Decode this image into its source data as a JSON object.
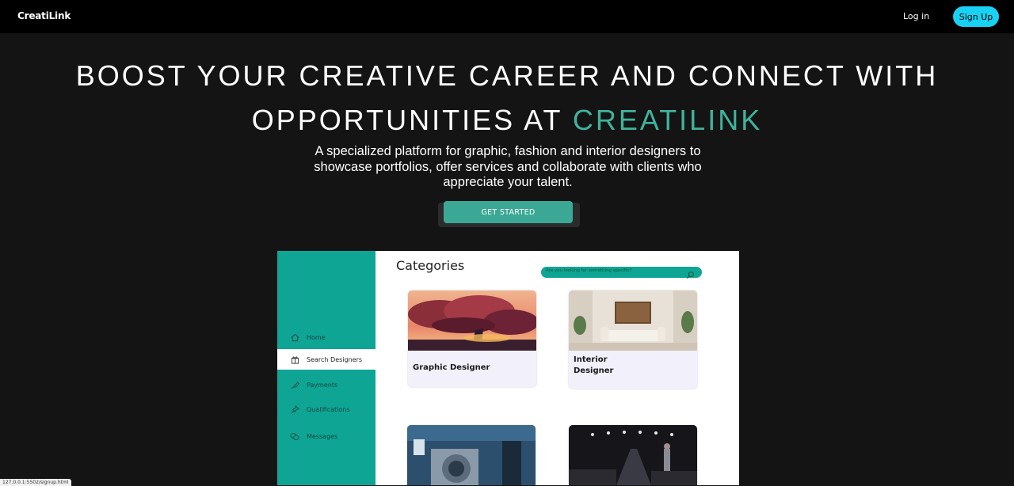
{
  "nav": {
    "logo": "CreatiLink",
    "login": "Log in",
    "signup": "Sign Up"
  },
  "hero": {
    "title_line1": "BOOST YOUR CREATIVE CAREER AND CONNECT WITH",
    "title_line2_prefix": "OPPORTUNITIES AT ",
    "title_brand": "CREATILINK",
    "subtitle": "A specialized platform for graphic, fashion and interior designers to showcase portfolios, offer services and collaborate with clients who appreciate your talent.",
    "cta": "GET STARTED"
  },
  "preview": {
    "sidebar": [
      {
        "label": "Home",
        "icon": "home-icon"
      },
      {
        "label": "Search Designers",
        "icon": "gift-icon"
      },
      {
        "label": "Payments",
        "icon": "feather-icon"
      },
      {
        "label": "Qualifications",
        "icon": "pin-icon"
      },
      {
        "label": "Messages",
        "icon": "chat-icon"
      }
    ],
    "categories_title": "Categories",
    "search_placeholder": "Are you looking for something specific?",
    "cards": [
      {
        "label": "Graphic Designer"
      },
      {
        "label_line1": "Interior",
        "label_line2": "Designer"
      },
      {
        "label": ""
      },
      {
        "label": ""
      }
    ]
  },
  "status_url": "127.0.0.1:5502/signup.html",
  "colors": {
    "accent": "#3fb39c",
    "signup": "#19d1f2",
    "sidebar": "#0fa594",
    "background": "#141414"
  }
}
